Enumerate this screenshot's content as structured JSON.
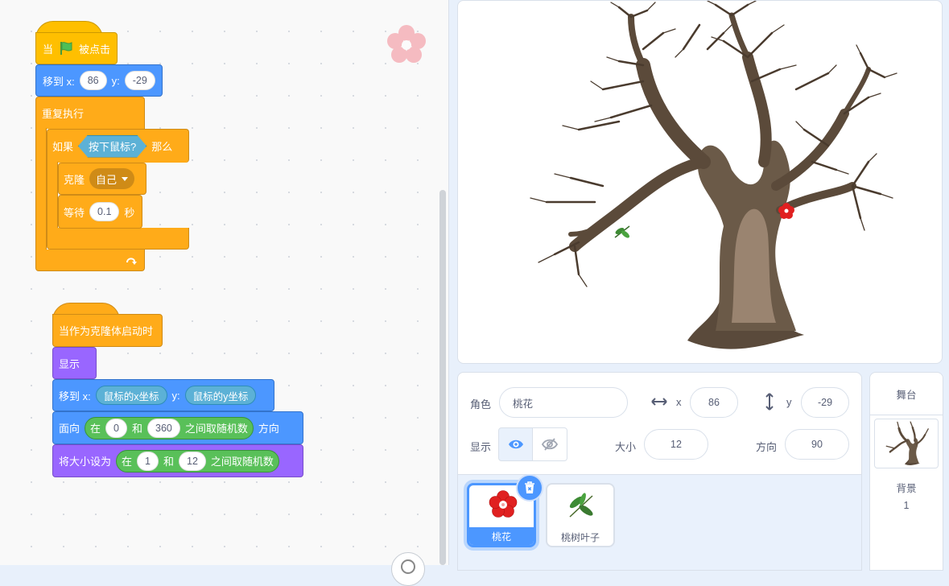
{
  "scripts": {
    "script1": {
      "when_flag": {
        "when": "当",
        "clicked": "被点击"
      },
      "goto": {
        "label": "移到 x:",
        "x": "86",
        "ylabel": "y:",
        "y": "-29"
      },
      "forever": "重复执行",
      "if": {
        "label": "如果",
        "condition": "按下鼠标?",
        "then": "那么"
      },
      "clone": {
        "label": "克隆",
        "target": "自己"
      },
      "wait": {
        "label": "等待",
        "value": "0.1",
        "unit": "秒"
      }
    },
    "script2": {
      "hat": "当作为克隆体启动时",
      "show": "显示",
      "goto": {
        "label": "移到 x:",
        "x": "鼠标的x坐标",
        "ylabel": "y:",
        "y": "鼠标的y坐标"
      },
      "point": {
        "label": "面向",
        "in": "在",
        "from": "0",
        "and": "和",
        "to": "360",
        "random": "之间取随机数",
        "dir": "方向"
      },
      "size": {
        "label": "将大小设为",
        "in": "在",
        "from": "1",
        "and": "和",
        "to": "12",
        "random": "之间取随机数"
      }
    }
  },
  "sprite_info": {
    "sprite_label": "角色",
    "sprite_name": "桃花",
    "x_label": "x",
    "x": "86",
    "y_label": "y",
    "y": "-29",
    "show_label": "显示",
    "size_label": "大小",
    "size": "12",
    "direction_label": "方向",
    "direction": "90",
    "visible": true
  },
  "sprites": [
    {
      "name": "桃花",
      "selected": true,
      "icon": "peach-blossom-icon"
    },
    {
      "name": "桃树叶子",
      "selected": false,
      "icon": "leaf-icon"
    }
  ],
  "stage_selector": {
    "title": "舞台",
    "backdrops_label": "背景",
    "backdrop_count": "1"
  },
  "colors": {
    "events": "#ffbf00",
    "motion": "#4c97ff",
    "control": "#ffab19",
    "looks": "#9966ff",
    "sensing": "#5cb1d6",
    "operators": "#59c059"
  }
}
